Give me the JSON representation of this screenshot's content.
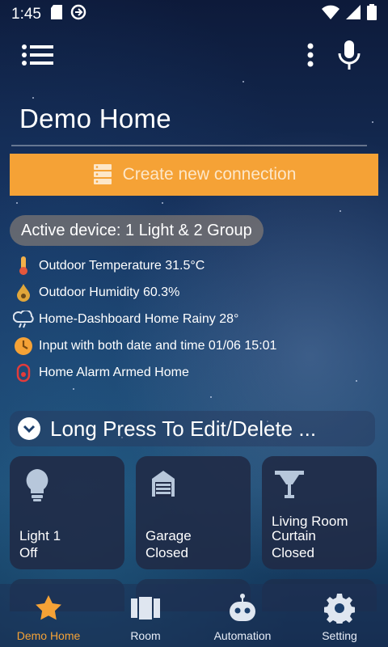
{
  "status_bar": {
    "time": "1:45"
  },
  "page": {
    "title": "Demo Home",
    "create_button_label": "Create new connection",
    "active_device": "Active device: 1 Light & 2 Group"
  },
  "info_items": [
    {
      "icon": "thermometer-icon",
      "text": "Outdoor Temperature 31.5°C"
    },
    {
      "icon": "humidity-drop-icon",
      "text": "Outdoor Humidity 60.3%"
    },
    {
      "icon": "cloud-rain-icon",
      "text": "Home-Dashboard Home Rainy 28°"
    },
    {
      "icon": "clock-icon",
      "text": "Input with both date and time 01/06 15:01"
    },
    {
      "icon": "alarm-icon",
      "text": "Home Alarm Armed Home"
    }
  ],
  "section": {
    "header": "Long Press To Edit/Delete ..."
  },
  "tiles": [
    {
      "icon": "bulb-icon",
      "name": "Light 1",
      "state": "Off"
    },
    {
      "icon": "garage-icon",
      "name": "Garage",
      "state": "Closed"
    },
    {
      "icon": "curtain-icon",
      "name": "Living Room Curtain",
      "state": "Closed"
    }
  ],
  "bottom_nav": [
    {
      "icon": "star-icon",
      "label": "Demo Home",
      "active": true
    },
    {
      "icon": "room-icon",
      "label": "Room",
      "active": false
    },
    {
      "icon": "robot-icon",
      "label": "Automation",
      "active": false
    },
    {
      "icon": "gear-icon",
      "label": "Setting",
      "active": false
    }
  ],
  "colors": {
    "accent": "#f5a236",
    "tile_bg": "#202a46",
    "background": "#16305a"
  }
}
